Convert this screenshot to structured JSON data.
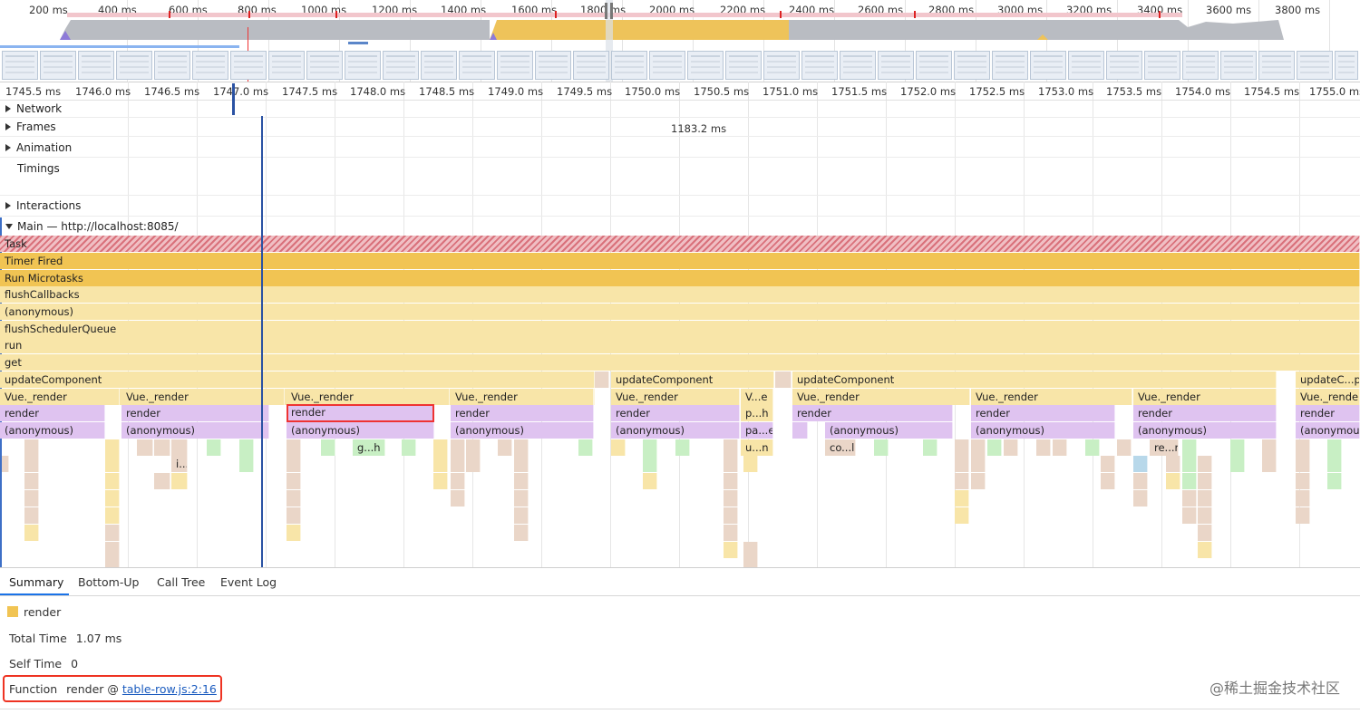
{
  "overview": {
    "ticks": [
      "200 ms",
      "400 ms",
      "600 ms",
      "800 ms",
      "1000 ms",
      "1200 ms",
      "1400 ms",
      "1600 ms",
      "1800 ms",
      "2000 ms",
      "2200 ms",
      "2400 ms",
      "2600 ms",
      "2800 ms",
      "3000 ms",
      "3200 ms",
      "3400 ms",
      "3600 ms",
      "3800 ms"
    ]
  },
  "ruler": {
    "ticks": [
      "1745.5 ms",
      "1746.0 ms",
      "1746.5 ms",
      "1747.0 ms",
      "1747.5 ms",
      "1748.0 ms",
      "1748.5 ms",
      "1749.0 ms",
      "1749.5 ms",
      "1750.0 ms",
      "1750.5 ms",
      "1751.0 ms",
      "1751.5 ms",
      "1752.0 ms",
      "1752.5 ms",
      "1753.0 ms",
      "1753.5 ms",
      "1754.0 ms",
      "1754.5 ms",
      "1755.0 ms"
    ]
  },
  "tracks": {
    "network": "Network",
    "frames": "Frames",
    "frames_duration": "1183.2 ms",
    "animation": "Animation",
    "timings": "Timings",
    "interactions": "Interactions",
    "main": "Main — http://localhost:8085/"
  },
  "flame": {
    "task": "Task",
    "timer_fired": "Timer Fired",
    "run_microtasks": "Run Microtasks",
    "flush_callbacks": "flushCallbacks",
    "anonymous": "(anonymous)",
    "flush_scheduler_queue": "flushSchedulerQueue",
    "run": "run",
    "get": "get",
    "update_component": "updateComponent",
    "update_component_short": "updateC...po",
    "vue_render": "Vue._render",
    "vue_render_short": "V...e",
    "render": "render",
    "small": {
      "g_h": "g...h",
      "i": "i...",
      "p_h": "p...h",
      "pa_e": "pa...e",
      "u_n": "u...n",
      "co_l": "co...l",
      "re_r": "re...r"
    }
  },
  "tabs": [
    "Summary",
    "Bottom-Up",
    "Call Tree",
    "Event Log"
  ],
  "summary": {
    "name": "render",
    "swatch_color": "#f1c453",
    "total_time_label": "Total Time",
    "total_time_value": "1.07 ms",
    "self_time_label": "Self Time",
    "self_time_value": "0",
    "function_label": "Function",
    "function_name": "render @",
    "function_link": "table-row.js:2:16"
  },
  "watermark": "@稀土掘金技术社区"
}
